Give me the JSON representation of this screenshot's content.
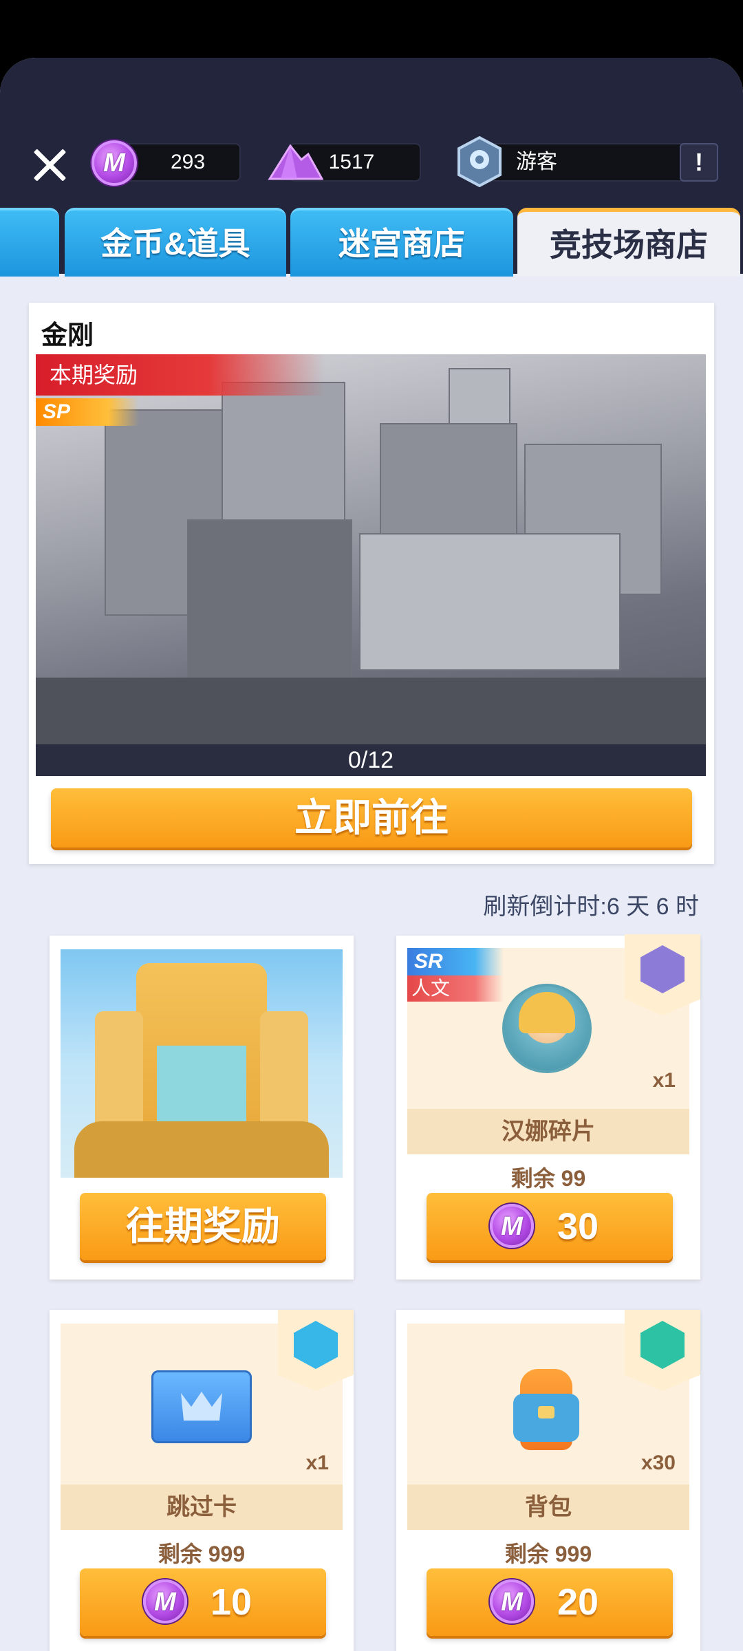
{
  "header": {
    "currency_m": "293",
    "currency_crystal": "1517",
    "player": "游客",
    "info_icon": "!"
  },
  "tabs": [
    {
      "label": ""
    },
    {
      "label": "金币&道具"
    },
    {
      "label": "迷宫商店"
    },
    {
      "label": "竞技场商店"
    }
  ],
  "hero": {
    "title": "金刚",
    "ribbon": "本期奖励",
    "rarity": "SP",
    "progress": "0/12",
    "progress_fraction": 0,
    "go_button": "立即前往"
  },
  "refresh_text": "刷新倒计时:6 天 6 时",
  "past_rewards_button": "往期奖励",
  "items": [
    {
      "rarity": "SR",
      "category": "人文",
      "name": "汉娜碎片",
      "qty": "x1",
      "remain": "剩余 99",
      "price": "30",
      "icon": "hanna-portrait-icon",
      "tag_color": "#8d7bd8"
    },
    {
      "name": "跳过卡",
      "qty": "x1",
      "remain": "剩余 999",
      "price": "10",
      "icon": "skip-card-icon",
      "tag_color": "#37b6e8"
    },
    {
      "name": "背包",
      "qty": "x30",
      "remain": "剩余 999",
      "price": "20",
      "icon": "backpack-icon",
      "tag_color": "#2ec2a4"
    }
  ]
}
